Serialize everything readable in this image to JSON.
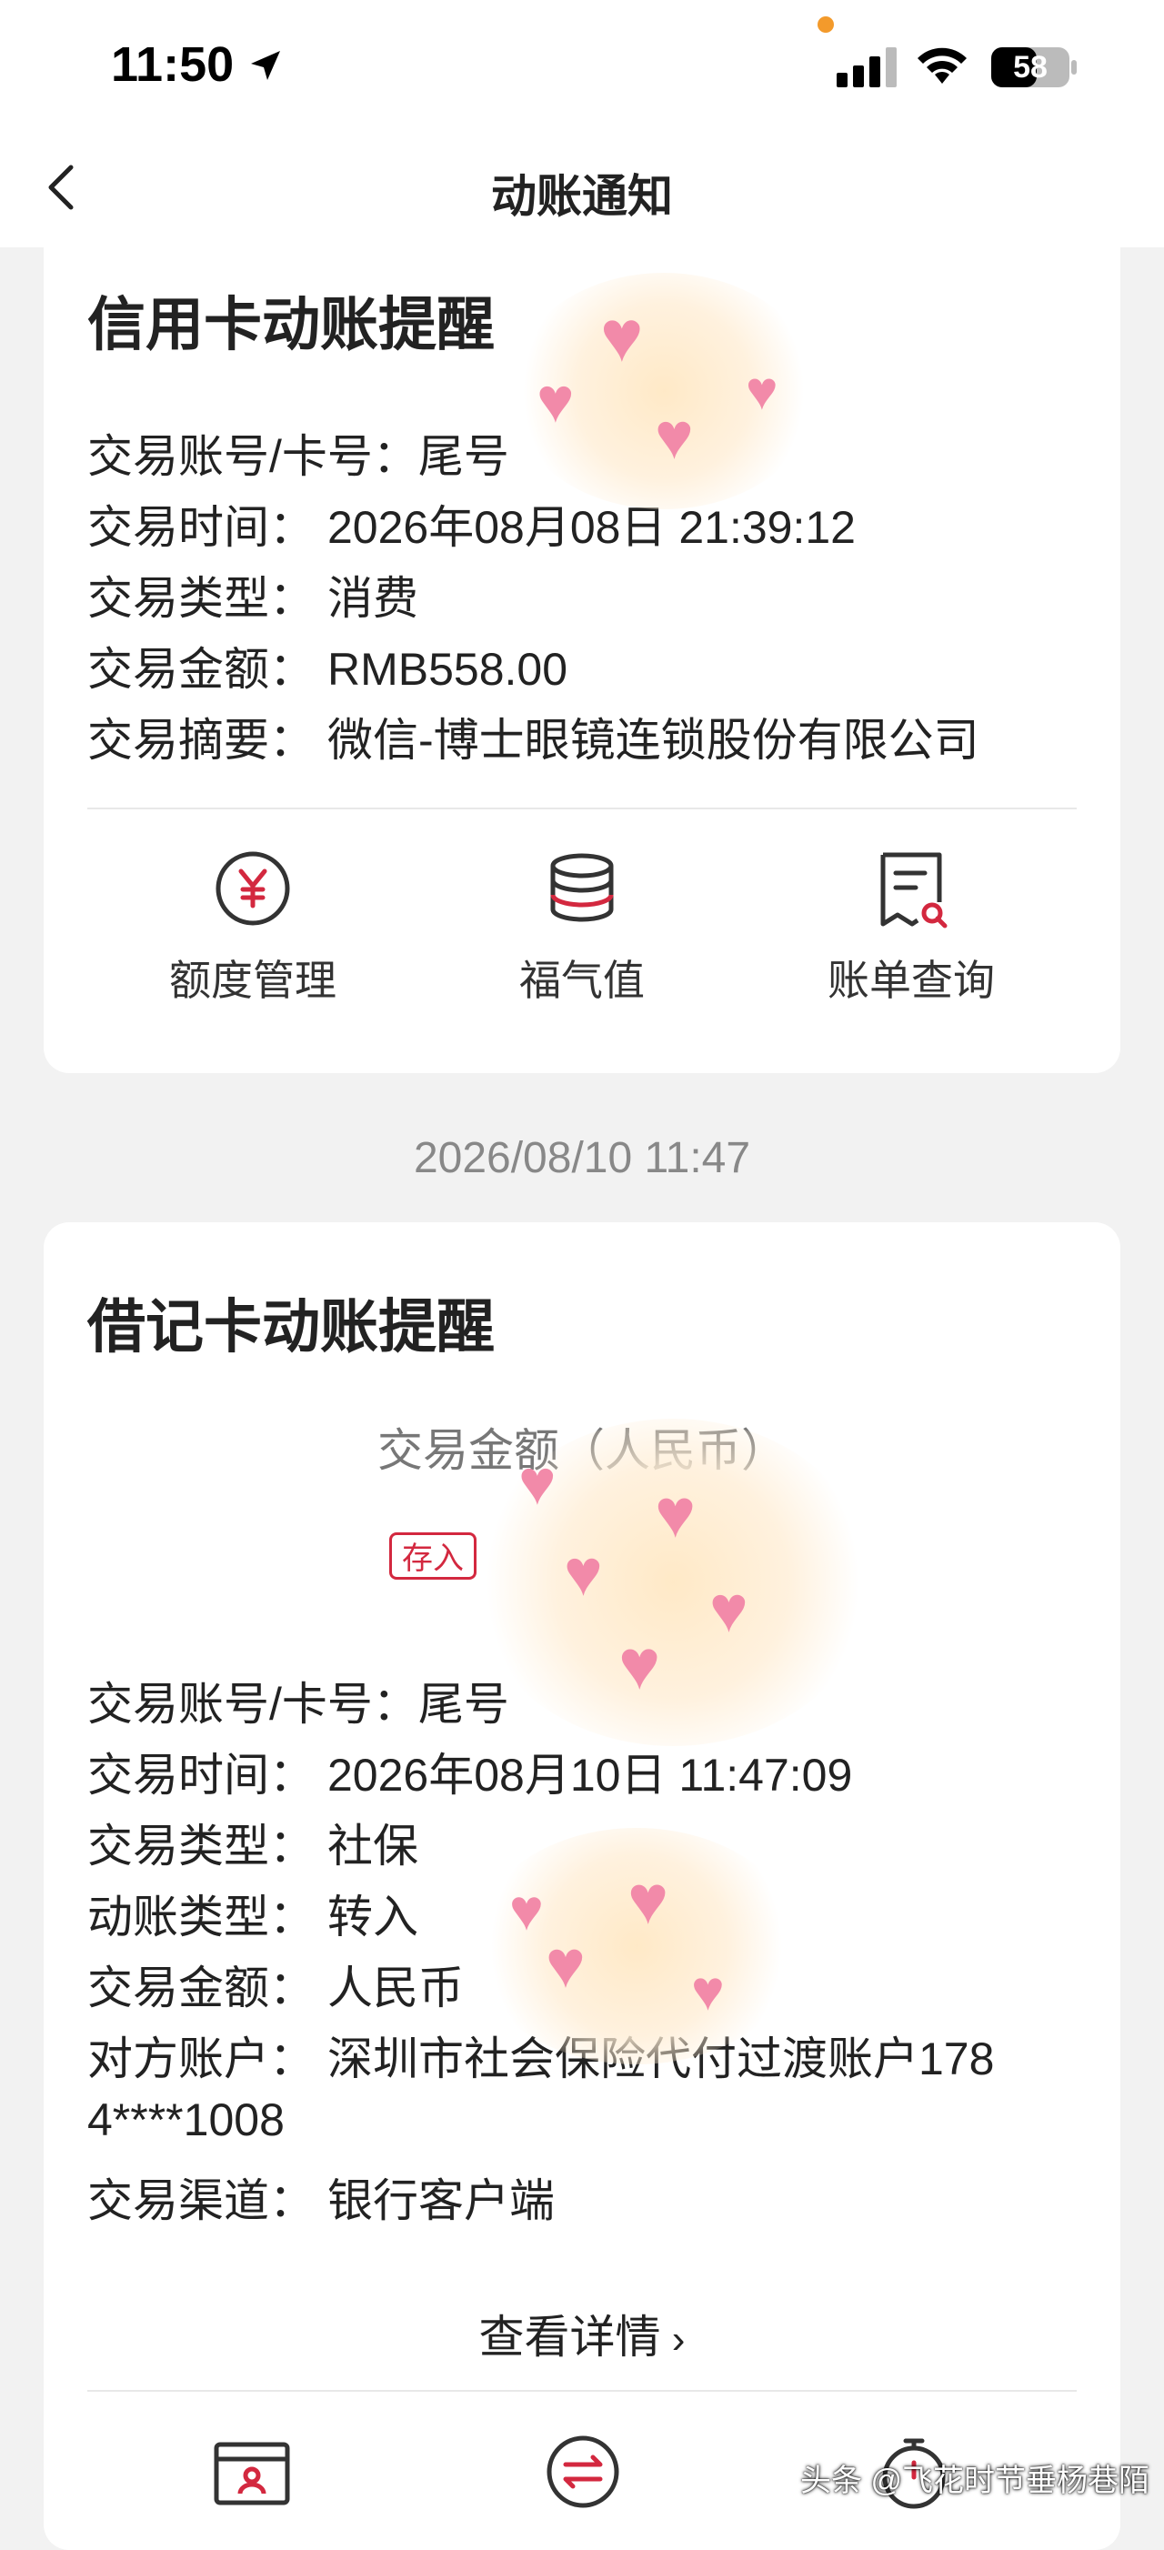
{
  "status_bar": {
    "time": "11:50",
    "battery": "58"
  },
  "nav": {
    "title": "动账通知"
  },
  "credit_card": {
    "title": "信用卡动账提醒",
    "rows": [
      {
        "label": "交易账号/卡号：",
        "value": "尾号"
      },
      {
        "label": "交易时间：",
        "value": "2026年08月08日 21:39:12"
      },
      {
        "label": "交易类型：",
        "value": "消费"
      },
      {
        "label": "交易金额：",
        "value": "RMB558.00"
      },
      {
        "label": "交易摘要：",
        "value": "微信-博士眼镜连锁股份有限公司"
      }
    ],
    "actions": [
      {
        "label": "额度管理",
        "icon": "yuan-circle-icon"
      },
      {
        "label": "福气值",
        "icon": "coin-stack-icon"
      },
      {
        "label": "账单查询",
        "icon": "bill-search-icon"
      }
    ]
  },
  "timestamp": "2026/08/10 11:47",
  "debit_card": {
    "title": "借记卡动账提醒",
    "amount_label": "交易金额（人民币）",
    "badge": "存入",
    "rows": [
      {
        "label": "交易账号/卡号：",
        "value": "尾号"
      },
      {
        "label": "交易时间：",
        "value": "2026年08月10日 11:47:09"
      },
      {
        "label": "交易类型：",
        "value": "社保"
      },
      {
        "label": "动账类型：",
        "value": "转入"
      },
      {
        "label": "交易金额：",
        "value": "人民币"
      },
      {
        "label": "对方账户：",
        "value": "深圳市社会保险代付过渡账户178"
      },
      {
        "label": "",
        "value": "4****1008"
      },
      {
        "label": "交易渠道：",
        "value": "银行客户端"
      }
    ],
    "details_link": "查看详情",
    "bottom_icons": [
      "id-card-icon",
      "transfer-icon",
      "timer-icon"
    ]
  },
  "watermark": "头条 @飞花时节垂杨巷陌",
  "colors": {
    "accent": "#d3283f",
    "heart": "#f28aa9",
    "background": "#f2f2f2"
  }
}
